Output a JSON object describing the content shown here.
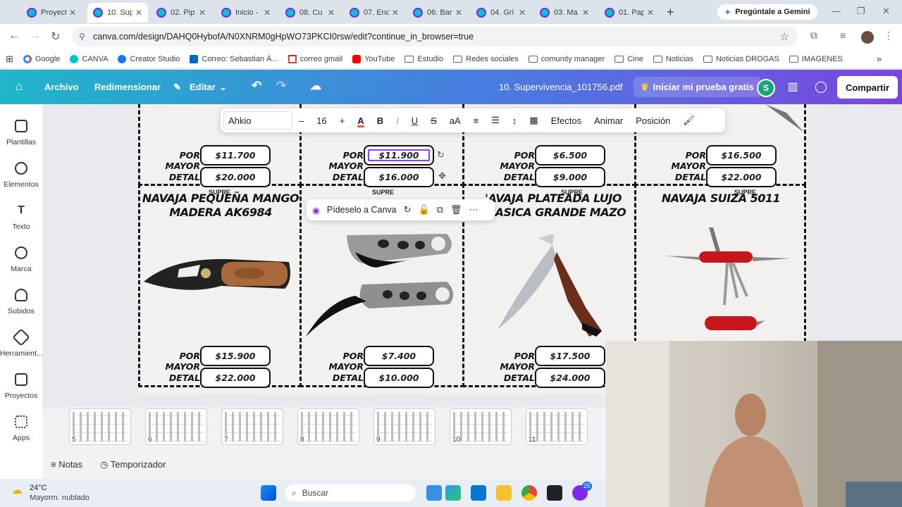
{
  "browser": {
    "tabs": [
      {
        "label": "Proyect",
        "active": false
      },
      {
        "label": "10. Sup",
        "active": true
      },
      {
        "label": "02. Pip",
        "active": false
      },
      {
        "label": "Inicio -",
        "active": false
      },
      {
        "label": "08. Cu",
        "active": false
      },
      {
        "label": "07. Enc",
        "active": false
      },
      {
        "label": "06. Bar",
        "active": false
      },
      {
        "label": "04. Gri",
        "active": false
      },
      {
        "label": "03. Ma",
        "active": false
      },
      {
        "label": "01. Pap",
        "active": false
      }
    ],
    "new_tab": "+",
    "gemini_label": "Pregúntale a Gemini",
    "url": "canva.com/design/DAHQ0HybofA/N0XNRM0gHpWO73PKCI0rsw/edit?continue_in_browser=true",
    "bookmarks": [
      {
        "label": "Google",
        "icon": "google-icon"
      },
      {
        "label": "CANVA",
        "icon": "canva-icon"
      },
      {
        "label": "Creator Studio",
        "icon": "facebook-icon"
      },
      {
        "label": "Correo: Sebastian Á...",
        "icon": "mail-icon"
      },
      {
        "label": "correo gmail",
        "icon": "gmail-icon"
      },
      {
        "label": "YouTube",
        "icon": "youtube-icon"
      },
      {
        "label": "Estudio",
        "icon": "folder-icon"
      },
      {
        "label": "Redes sociales",
        "icon": "folder-icon"
      },
      {
        "label": "comunity manager",
        "icon": "folder-icon"
      },
      {
        "label": "Cine",
        "icon": "folder-icon"
      },
      {
        "label": "Noticias",
        "icon": "folder-icon"
      },
      {
        "label": "Noticias DROGAS",
        "icon": "folder-icon"
      },
      {
        "label": "IMAGENES",
        "icon": "folder-icon"
      }
    ]
  },
  "canva": {
    "menu": {
      "archivo": "Archivo",
      "redimensionar": "Redimensionar",
      "editar": "Editar"
    },
    "doc_title": "10. Supervivencia_101756.pdf",
    "trial_label": "Iniciar mi prueba gratis",
    "avatar_letter": "S",
    "share_label": "Compartir",
    "sidebar": [
      {
        "label": "Plantillas",
        "icon": "templates-icon"
      },
      {
        "label": "Elementos",
        "icon": "elements-icon"
      },
      {
        "label": "Texto",
        "icon": "text-icon"
      },
      {
        "label": "Marca",
        "icon": "brand-icon"
      },
      {
        "label": "Subidos",
        "icon": "upload-icon"
      },
      {
        "label": "Herramient...",
        "icon": "tools-icon"
      },
      {
        "label": "Proyectos",
        "icon": "folder-icon"
      },
      {
        "label": "Apps",
        "icon": "apps-icon"
      }
    ],
    "text_toolbar": {
      "font": "Ahkio",
      "font_size": "16",
      "minus": "–",
      "plus": "+",
      "letter_a": "A",
      "bold": "B",
      "italic": "I",
      "underline": "U",
      "strike": "S",
      "case": "aA",
      "effects": "Efectos",
      "animate": "Animar",
      "position": "Posición"
    },
    "context_menu": {
      "ask_label": "Pídeselo a Canva"
    },
    "footer": {
      "notes": "Notas",
      "timer": "Temporizador"
    },
    "thumb_pages": [
      "5",
      "6",
      "7",
      "8",
      "9",
      "10",
      "11"
    ]
  },
  "catalog": {
    "label_wholesale": "POR MAYOR",
    "label_retail": "DETAL",
    "top_row": [
      {
        "wholesale": "$11.700",
        "retail": "$20.000"
      },
      {
        "wholesale": "$11.900",
        "retail": "$16.000"
      },
      {
        "wholesale": "$6.500",
        "retail": "$9.000"
      },
      {
        "wholesale": "$16.500",
        "retail": "$22.000"
      }
    ],
    "bottom_row": [
      {
        "title": "NAVAJA PEQUEÑA MANGO MADERA AK6984",
        "wholesale": "$15.900",
        "retail": "$22.000"
      },
      {
        "title": "",
        "wholesale": "$7.400",
        "retail": "$10.000"
      },
      {
        "title": "'AVAJA PLATEADA LUJO CLASICA GRANDE MAZO",
        "wholesale": "$17.500",
        "retail": "$24.000"
      },
      {
        "title": "NAVAJA SUIZA 5011",
        "wholesale": "",
        "retail": ""
      }
    ],
    "partial_label": "SUPRE"
  },
  "taskbar": {
    "temperature": "24°C",
    "weather": "Mayorm. nublado",
    "search_placeholder": "Buscar",
    "badge": "25"
  },
  "colors": {
    "canva_teal": "#1fb6c9",
    "canva_purple": "#7a45e0",
    "avatar_green": "#1aa67c"
  }
}
